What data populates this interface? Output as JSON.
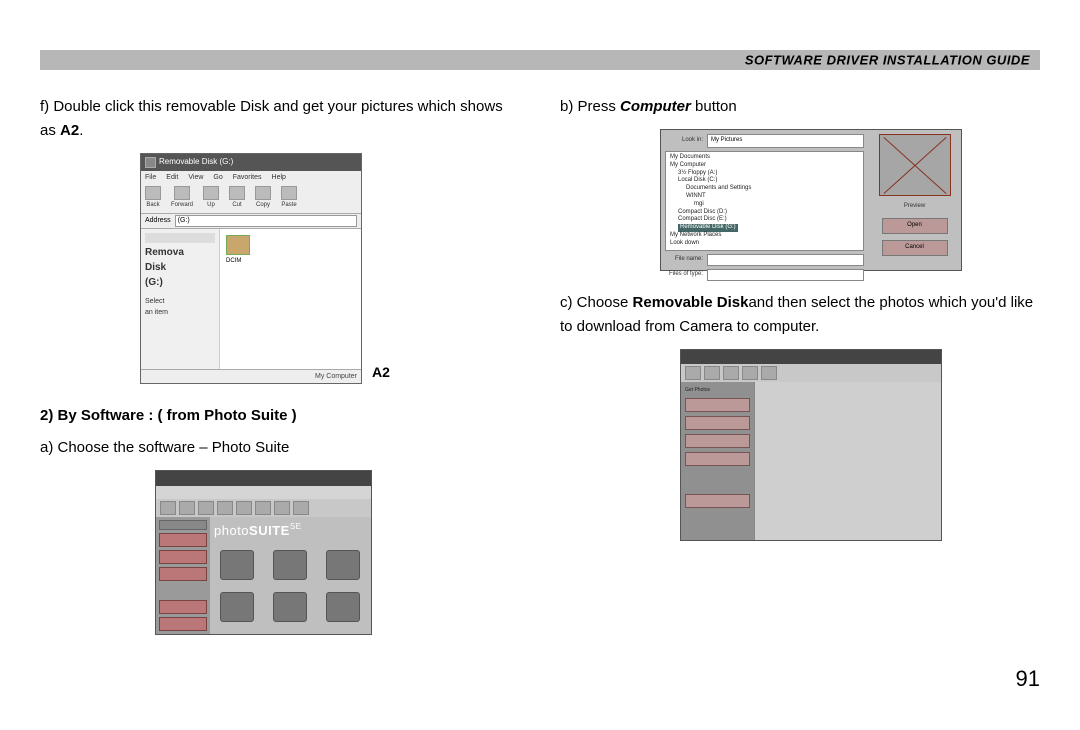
{
  "header": "Software Driver Installation Guide",
  "left": {
    "step_f_pre": "f) Double click this removable Disk and get your pictures which shows as ",
    "step_f_bold": "A2",
    "step_f_post": ".",
    "figA2_label": "A2",
    "section2": "2) By Software : ( from Photo Suite )",
    "step_a": "a) Choose the software – Photo Suite"
  },
  "right": {
    "step_b_pre": "b) Press ",
    "step_b_bold": "Computer",
    "step_b_post": " button",
    "step_c_pre": "c) Choose ",
    "step_c_bold": "Removable Disk",
    "step_c_post": "and then select  the photos which you'd like to download from Camera to computer."
  },
  "figA2": {
    "title": "Removable Disk (G:)",
    "menu": [
      "File",
      "Edit",
      "View",
      "Go",
      "Favorites",
      "Help"
    ],
    "toolbar": [
      "Back",
      "Forward",
      "Up",
      "Cut",
      "Copy",
      "Paste"
    ],
    "address_label": "Address",
    "address_value": "(G:)",
    "left_big1": "Remova",
    "left_big2": "Disk",
    "left_big3": "(G:)",
    "left_sub1": "Select",
    "left_sub2": "an item",
    "folder_label": "DCIM",
    "status": "My Computer"
  },
  "figPS": {
    "logo_thin": "photo",
    "logo_bold": "SUITE",
    "logo_suffix": "SE"
  },
  "figOpen": {
    "lookin": "Look in:",
    "lookin_val": "My Pictures",
    "tree": {
      "t0": "My Documents",
      "t1": "My Computer",
      "t2": "3½ Floppy (A:)",
      "t3": "Local Disk (C:)",
      "t4": "Documents and Settings",
      "t5": "WINNT",
      "t6": "mgi",
      "t7": "Compact Disc (D:)",
      "t8": "Compact Disc (E:)",
      "t9": "Removable Disk (G:)",
      "t10": "My Network Places",
      "t11": "Look down"
    },
    "file_name": "File name:",
    "file_type": "Files of type:",
    "btn_open": "Open",
    "btn_cancel": "Cancel",
    "preview": "Preview"
  },
  "figDL": {
    "side_label": "Get Photos"
  },
  "page_number": "91"
}
